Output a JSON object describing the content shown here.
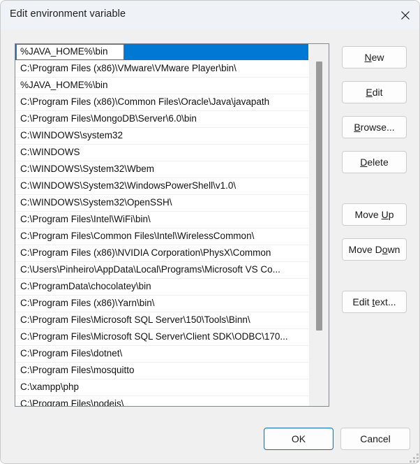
{
  "window": {
    "title": "Edit environment variable",
    "close_icon": "close-icon",
    "accent_color": "#0078d4",
    "background_color": "#f0f0f0",
    "titlebar_color": "#eff3f8"
  },
  "list": {
    "editing_row_index": 0,
    "editing_value": "%JAVA_HOME%\\bin",
    "items": [
      "%JAVA_HOME%\\bin",
      "C:\\Program Files (x86)\\VMware\\VMware Player\\bin\\",
      "%JAVA_HOME%\\bin",
      "C:\\Program Files (x86)\\Common Files\\Oracle\\Java\\javapath",
      "C:\\Program Files\\MongoDB\\Server\\6.0\\bin",
      "C:\\WINDOWS\\system32",
      "C:\\WINDOWS",
      "C:\\WINDOWS\\System32\\Wbem",
      "C:\\WINDOWS\\System32\\WindowsPowerShell\\v1.0\\",
      "C:\\WINDOWS\\System32\\OpenSSH\\",
      "C:\\Program Files\\Intel\\WiFi\\bin\\",
      "C:\\Program Files\\Common Files\\Intel\\WirelessCommon\\",
      "C:\\Program Files (x86)\\NVIDIA Corporation\\PhysX\\Common",
      "C:\\Users\\Pinheiro\\AppData\\Local\\Programs\\Microsoft VS Co...",
      "C:\\ProgramData\\chocolatey\\bin",
      "C:\\Program Files (x86)\\Yarn\\bin\\",
      "C:\\Program Files\\Microsoft SQL Server\\150\\Tools\\Binn\\",
      "C:\\Program Files\\Microsoft SQL Server\\Client SDK\\ODBC\\170...",
      "C:\\Program Files\\dotnet\\",
      "C:\\Program Files\\mosquitto",
      "C:\\xampp\\php",
      "C:\\Program Files\\nodejs\\"
    ]
  },
  "buttons": {
    "new": {
      "prefix": "",
      "accel": "N",
      "suffix": "ew"
    },
    "edit": {
      "prefix": "",
      "accel": "E",
      "suffix": "dit"
    },
    "browse": {
      "prefix": "",
      "accel": "B",
      "suffix": "rowse..."
    },
    "delete": {
      "prefix": "",
      "accel": "D",
      "suffix": "elete"
    },
    "move_up": {
      "prefix": "Move ",
      "accel": "U",
      "suffix": "p"
    },
    "move_down": {
      "prefix": "Move D",
      "accel": "o",
      "suffix": "wn"
    },
    "edit_text": {
      "prefix": "Edit ",
      "accel": "t",
      "suffix": "ext..."
    },
    "ok": "OK",
    "cancel": "Cancel"
  }
}
